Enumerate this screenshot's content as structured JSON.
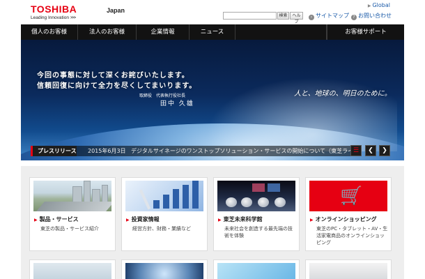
{
  "header": {
    "logo_text": "TOSHIBA",
    "tagline": "Leading Innovation",
    "tagline_arrows": ">>>",
    "region": "Japan",
    "global_link": "Global",
    "search_button": "検索",
    "help_button": "ヘルプ",
    "sitemap_link": "サイトマップ",
    "contact_link": "お問い合わせ"
  },
  "nav": {
    "items": [
      "個人のお客様",
      "法人のお客様",
      "企業情報",
      "ニュース"
    ],
    "support": "お客様サポート"
  },
  "hero": {
    "apology_line1": "今回の事態に対して深くお詫びいたします。",
    "apology_line2": "信頼回復に向けて全力を尽くしてまいります。",
    "signature_title": "取締役　代表執行役社長",
    "signature_name": "田中 久雄",
    "slogan": "人と、地球の、明日のために。"
  },
  "press": {
    "label": "プレスリリース",
    "date": "2015年6月3日",
    "text": "デジタルサイネージのワンストップソリューション・サービスの開始について（東芝ライ"
  },
  "cards": [
    {
      "title": "製品・サービス",
      "desc": "東芝の製品・サービス紹介"
    },
    {
      "title": "投資家情報",
      "desc": "経営方針、財務・業績など"
    },
    {
      "title": "東芝未来科学館",
      "desc": "未来社会を創造する最先端の技術を体験"
    },
    {
      "title": "オンラインショッピング",
      "desc": "東芝のPC・タブレット・AV・生活家電商品のオンラインショッピング"
    }
  ],
  "colors": {
    "brand_red": "#e60012",
    "nav_black": "#121212",
    "link_blue": "#1a5aa8"
  },
  "icons": {
    "cart": "shopping-cart-icon",
    "prev": "chevron-left-icon",
    "next": "chevron-right-icon",
    "menu": "list-icon"
  }
}
